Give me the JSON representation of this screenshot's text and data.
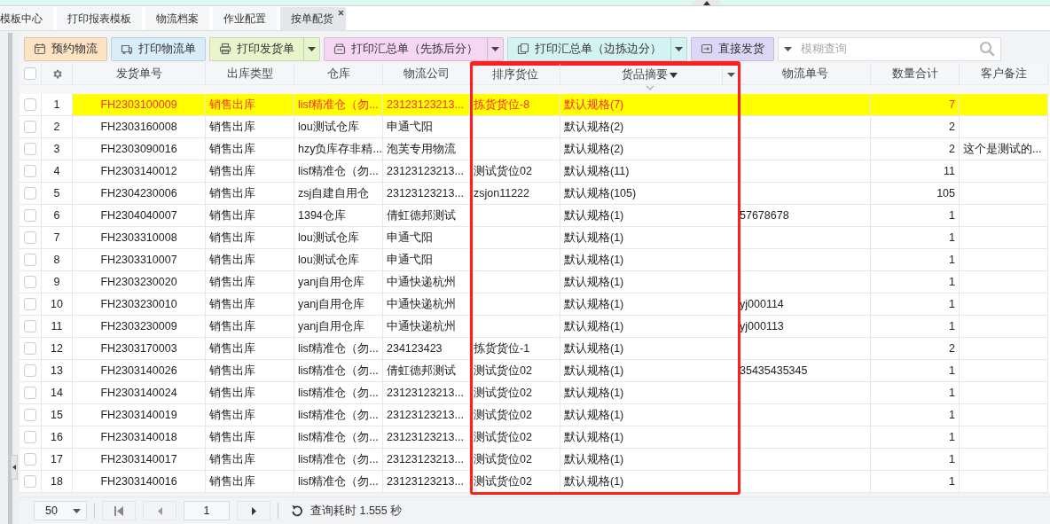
{
  "tabs": [
    {
      "label": "模板中心",
      "selected": false,
      "closable": false
    },
    {
      "label": "打印报表模板",
      "selected": false,
      "closable": false
    },
    {
      "label": "物流档案",
      "selected": false,
      "closable": false
    },
    {
      "label": "作业配置",
      "selected": false,
      "closable": false
    },
    {
      "label": "按单配货",
      "selected": true,
      "closable": true
    }
  ],
  "toolbar": {
    "buttons": [
      {
        "label": "预约物流",
        "color": "#fbe3c4",
        "dropdown": false
      },
      {
        "label": "打印物流单",
        "color": "#d8edf8",
        "dropdown": false
      },
      {
        "label": "打印发货单",
        "color": "#e8f5cc",
        "dropdown": true
      },
      {
        "label": "打印汇总单（先拣后分）",
        "color": "#f5d6f3",
        "dropdown": true
      },
      {
        "label": "打印汇总单（边拣边分）",
        "color": "#d3f3f2",
        "dropdown": true
      },
      {
        "label": "直接发货",
        "color": "#ddd7f6",
        "dropdown": false
      }
    ],
    "search": {
      "placeholder": "模糊查询"
    }
  },
  "table": {
    "all_checked": false,
    "columns": [
      {
        "label": "发货单号",
        "highlighted": false,
        "sorted": false,
        "hovered": false
      },
      {
        "label": "出库类型",
        "highlighted": false,
        "sorted": false,
        "hovered": false
      },
      {
        "label": "仓库",
        "highlighted": false,
        "sorted": false,
        "hovered": false
      },
      {
        "label": "物流公司",
        "highlighted": false,
        "sorted": false,
        "hovered": false
      },
      {
        "label": "排序货位",
        "highlighted": true,
        "sorted": false,
        "hovered": false
      },
      {
        "label": "货品摘要",
        "highlighted": true,
        "sorted": true,
        "hovered": true
      },
      {
        "label": "物流单号",
        "highlighted": false,
        "sorted": false,
        "hovered": false
      },
      {
        "label": "数量合计",
        "highlighted": false,
        "sorted": false,
        "hovered": false
      },
      {
        "label": "客户备注",
        "highlighted": false,
        "sorted": false,
        "hovered": false
      }
    ],
    "rows": [
      {
        "no": "1",
        "checked": false,
        "highlighted": true,
        "order_no": "FH2303100009",
        "type": "销售出库",
        "warehouse": "lisf精准仓（勿...",
        "carrier": "23123123213...",
        "bin": "拣货货位-8",
        "goods": "默认规格(7)",
        "qty": "7"
      },
      {
        "no": "2",
        "checked": false,
        "highlighted": false,
        "order_no": "FH2303160008",
        "type": "销售出库",
        "warehouse": "lou测试仓库",
        "carrier": "申通弋阳",
        "goods": "默认规格(2)",
        "qty": "2"
      },
      {
        "no": "3",
        "checked": false,
        "highlighted": false,
        "order_no": "FH2303090016",
        "type": "销售出库",
        "warehouse": "hzy负库存非精...",
        "carrier": "泡芙专用物流",
        "goods": "默认规格(2)",
        "qty": "2",
        "remark": "这个是测试的..."
      },
      {
        "no": "4",
        "checked": false,
        "highlighted": false,
        "order_no": "FH2303140012",
        "type": "销售出库",
        "warehouse": "lisf精准仓（勿...",
        "carrier": "23123123213...",
        "bin": "测试货位02",
        "goods": "默认规格(11)",
        "qty": "11"
      },
      {
        "no": "5",
        "checked": false,
        "highlighted": false,
        "order_no": "FH2304230006",
        "type": "销售出库",
        "warehouse": "zsj自建自用仓",
        "carrier": "23123123213...",
        "bin": "zsjon11222",
        "goods": "默认规格(105)",
        "qty": "105"
      },
      {
        "no": "6",
        "checked": false,
        "highlighted": false,
        "order_no": "FH2304040007",
        "type": "销售出库",
        "warehouse": "1394仓库",
        "carrier": "倩虹德邦测试",
        "goods": "默认规格(1)",
        "tracking_no": "57678678",
        "qty": "1"
      },
      {
        "no": "7",
        "checked": false,
        "highlighted": false,
        "order_no": "FH2303310008",
        "type": "销售出库",
        "warehouse": "lou测试仓库",
        "carrier": "申通弋阳",
        "goods": "默认规格(1)",
        "qty": "1"
      },
      {
        "no": "8",
        "checked": false,
        "highlighted": false,
        "order_no": "FH2303310007",
        "type": "销售出库",
        "warehouse": "lou测试仓库",
        "carrier": "申通弋阳",
        "goods": "默认规格(1)",
        "qty": "1"
      },
      {
        "no": "9",
        "checked": false,
        "highlighted": false,
        "order_no": "FH2303230020",
        "type": "销售出库",
        "warehouse": "yanj自用仓库",
        "carrier": "中通快递杭州",
        "goods": "默认规格(1)",
        "qty": "1"
      },
      {
        "no": "10",
        "checked": false,
        "highlighted": false,
        "order_no": "FH2303230010",
        "type": "销售出库",
        "warehouse": "yanj自用仓库",
        "carrier": "中通快递杭州",
        "goods": "默认规格(1)",
        "tracking_no": "yj000114",
        "qty": "1"
      },
      {
        "no": "11",
        "checked": false,
        "highlighted": false,
        "order_no": "FH2303230009",
        "type": "销售出库",
        "warehouse": "yanj自用仓库",
        "carrier": "中通快递杭州",
        "goods": "默认规格(1)",
        "tracking_no": "yj000113",
        "qty": "1"
      },
      {
        "no": "12",
        "checked": false,
        "highlighted": false,
        "order_no": "FH2303170003",
        "type": "销售出库",
        "warehouse": "lisf精准仓（勿...",
        "carrier": "234123423",
        "bin": "拣货货位-1",
        "goods": "默认规格(1)",
        "qty": "2"
      },
      {
        "no": "13",
        "checked": false,
        "highlighted": false,
        "order_no": "FH2303140026",
        "type": "销售出库",
        "warehouse": "lisf精准仓（勿...",
        "carrier": "倩虹德邦测试",
        "bin": "测试货位02",
        "goods": "默认规格(1)",
        "tracking_no": "35435435345",
        "qty": "1"
      },
      {
        "no": "14",
        "checked": false,
        "highlighted": false,
        "order_no": "FH2303140024",
        "type": "销售出库",
        "warehouse": "lisf精准仓（勿...",
        "carrier": "23123123213...",
        "bin": "测试货位02",
        "goods": "默认规格(1)",
        "qty": "1"
      },
      {
        "no": "15",
        "checked": false,
        "highlighted": false,
        "order_no": "FH2303140019",
        "type": "销售出库",
        "warehouse": "lisf精准仓（勿...",
        "carrier": "23123123213...",
        "bin": "测试货位02",
        "goods": "默认规格(1)",
        "qty": "1"
      },
      {
        "no": "16",
        "checked": false,
        "highlighted": false,
        "order_no": "FH2303140018",
        "type": "销售出库",
        "warehouse": "lisf精准仓（勿...",
        "carrier": "23123123213...",
        "bin": "测试货位02",
        "goods": "默认规格(1)",
        "qty": "1"
      },
      {
        "no": "17",
        "checked": false,
        "highlighted": false,
        "order_no": "FH2303140017",
        "type": "销售出库",
        "warehouse": "lisf精准仓（勿...",
        "carrier": "23123123213...",
        "bin": "测试货位02",
        "goods": "默认规格(1)",
        "qty": "1"
      },
      {
        "no": "18",
        "checked": false,
        "highlighted": false,
        "order_no": "FH2303140016",
        "type": "销售出库",
        "warehouse": "lisf精准仓（勿...",
        "carrier": "23123123213...",
        "bin": "测试货位02",
        "goods": "默认规格(1)",
        "qty": "1"
      }
    ]
  },
  "pager": {
    "page_size": "50",
    "page": "1",
    "query_time": "查询耗时 1.555 秒"
  }
}
